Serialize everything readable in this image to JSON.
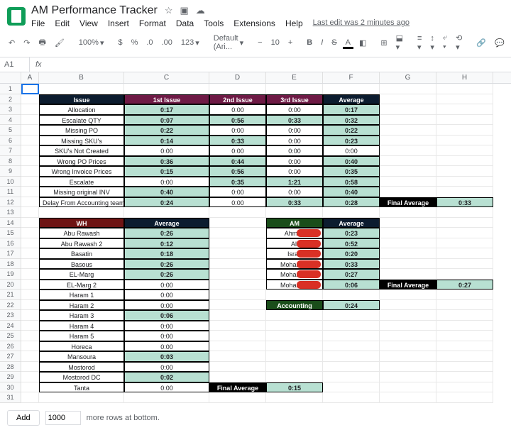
{
  "doc_title": "AM Performance Tracker",
  "menu": [
    "File",
    "Edit",
    "View",
    "Insert",
    "Format",
    "Data",
    "Tools",
    "Extensions",
    "Help"
  ],
  "last_edit": "Last edit was 2 minutes ago",
  "zoom": "100%",
  "format_num": "123",
  "font": "Default (Ari...",
  "font_size": "10",
  "namebox": "A1",
  "columns": [
    "A",
    "B",
    "C",
    "D",
    "E",
    "F",
    "G",
    "H"
  ],
  "t1": {
    "headers": [
      "Issue",
      "1st Issue",
      "2nd Issue",
      "3rd Issue",
      "Average"
    ],
    "rows": [
      {
        "label": "Allocation",
        "v": [
          "0:17",
          "0:00",
          "0:00",
          "0:17"
        ],
        "hi": [
          0,
          3
        ]
      },
      {
        "label": "Escalate QTY",
        "v": [
          "0:07",
          "0:56",
          "0:33",
          "0:32"
        ],
        "hi": [
          0,
          1,
          2,
          3
        ]
      },
      {
        "label": "Missing PO",
        "v": [
          "0:22",
          "0:00",
          "0:00",
          "0:22"
        ],
        "hi": [
          0,
          3
        ]
      },
      {
        "label": "Missing SKU's",
        "v": [
          "0:14",
          "0:33",
          "0:00",
          "0:23"
        ],
        "hi": [
          0,
          1,
          3
        ]
      },
      {
        "label": "SKU's Not Created",
        "v": [
          "0:00",
          "0:00",
          "0:00",
          "0:00"
        ],
        "hi": []
      },
      {
        "label": "Wrong PO Prices",
        "v": [
          "0:36",
          "0:44",
          "0:00",
          "0:40"
        ],
        "hi": [
          0,
          1,
          3
        ]
      },
      {
        "label": "Wrong Invoice Prices",
        "v": [
          "0:15",
          "0:56",
          "0:00",
          "0:35"
        ],
        "hi": [
          0,
          1,
          3
        ]
      },
      {
        "label": "Escalate",
        "v": [
          "0:00",
          "0:35",
          "1:21",
          "0:58"
        ],
        "hi": [
          1,
          2,
          3
        ]
      },
      {
        "label": "Missing original INV",
        "v": [
          "0:40",
          "0:00",
          "0:00",
          "0:40"
        ],
        "hi": [
          0,
          3
        ]
      },
      {
        "label": "Delay From Accounting team",
        "v": [
          "0:24",
          "0:00",
          "0:33",
          "0:28"
        ],
        "hi": [
          0,
          2,
          3
        ]
      }
    ],
    "final_label": "Final Average",
    "final": "0:33"
  },
  "t2": {
    "headers": [
      "WH",
      "Average"
    ],
    "rows": [
      {
        "l": "Abu Rawash",
        "v": "0:26",
        "hi": true
      },
      {
        "l": "Abu Rawash 2",
        "v": "0:12",
        "hi": true
      },
      {
        "l": "Basatin",
        "v": "0:18",
        "hi": true
      },
      {
        "l": "Basous",
        "v": "0:26",
        "hi": true
      },
      {
        "l": "EL-Marg",
        "v": "0:26",
        "hi": true
      },
      {
        "l": "EL-Marg 2",
        "v": "0:00",
        "hi": false
      },
      {
        "l": "Haram 1",
        "v": "0:00",
        "hi": false
      },
      {
        "l": "Haram 2",
        "v": "0:00",
        "hi": false
      },
      {
        "l": "Haram 3",
        "v": "0:06",
        "hi": true
      },
      {
        "l": "Haram 4",
        "v": "0:00",
        "hi": false
      },
      {
        "l": "Haram 5",
        "v": "0:00",
        "hi": false
      },
      {
        "l": "Horeca",
        "v": "0:00",
        "hi": false
      },
      {
        "l": "Mansoura",
        "v": "0:03",
        "hi": true
      },
      {
        "l": "Mostorod",
        "v": "0:00",
        "hi": false
      },
      {
        "l": "Mostorod DC",
        "v": "0:02",
        "hi": true
      },
      {
        "l": "Tanta",
        "v": "0:00",
        "hi": false
      }
    ],
    "final_label": "Final Average",
    "final": "0:15"
  },
  "t3": {
    "headers": [
      "AM",
      "Average"
    ],
    "rows": [
      {
        "l": "Ahmed",
        "v": "0:23"
      },
      {
        "l": "Ali",
        "v": "0:52"
      },
      {
        "l": "Israa",
        "v": "0:20"
      },
      {
        "l": "Mohamed",
        "v": "0:33"
      },
      {
        "l": "Mohamed",
        "v": "0:27"
      },
      {
        "l": "Mohamed",
        "v": "0:06"
      }
    ],
    "final_label": "Final Average",
    "final": "0:27"
  },
  "acc_label": "Accounting",
  "acc_val": "0:24",
  "add_btn": "Add",
  "add_input": "1000",
  "add_text": "more rows at bottom.",
  "chart_data": {
    "type": "table",
    "tables": [
      {
        "name": "Issue",
        "columns": [
          "Issue",
          "1st Issue",
          "2nd Issue",
          "3rd Issue",
          "Average"
        ],
        "rows": [
          [
            "Allocation",
            "0:17",
            "0:00",
            "0:00",
            "0:17"
          ],
          [
            "Escalate QTY",
            "0:07",
            "0:56",
            "0:33",
            "0:32"
          ],
          [
            "Missing PO",
            "0:22",
            "0:00",
            "0:00",
            "0:22"
          ],
          [
            "Missing SKU's",
            "0:14",
            "0:33",
            "0:00",
            "0:23"
          ],
          [
            "SKU's Not Created",
            "0:00",
            "0:00",
            "0:00",
            "0:00"
          ],
          [
            "Wrong PO Prices",
            "0:36",
            "0:44",
            "0:00",
            "0:40"
          ],
          [
            "Wrong Invoice Prices",
            "0:15",
            "0:56",
            "0:00",
            "0:35"
          ],
          [
            "Escalate",
            "0:00",
            "0:35",
            "1:21",
            "0:58"
          ],
          [
            "Missing original INV",
            "0:40",
            "0:00",
            "0:00",
            "0:40"
          ],
          [
            "Delay From Accounting team",
            "0:24",
            "0:00",
            "0:33",
            "0:28"
          ]
        ],
        "final": "0:33"
      },
      {
        "name": "WH",
        "columns": [
          "WH",
          "Average"
        ],
        "rows": [
          [
            "Abu Rawash",
            "0:26"
          ],
          [
            "Abu Rawash 2",
            "0:12"
          ],
          [
            "Basatin",
            "0:18"
          ],
          [
            "Basous",
            "0:26"
          ],
          [
            "EL-Marg",
            "0:26"
          ],
          [
            "EL-Marg 2",
            "0:00"
          ],
          [
            "Haram 1",
            "0:00"
          ],
          [
            "Haram 2",
            "0:00"
          ],
          [
            "Haram 3",
            "0:06"
          ],
          [
            "Haram 4",
            "0:00"
          ],
          [
            "Haram 5",
            "0:00"
          ],
          [
            "Horeca",
            "0:00"
          ],
          [
            "Mansoura",
            "0:03"
          ],
          [
            "Mostorod",
            "0:00"
          ],
          [
            "Mostorod DC",
            "0:02"
          ],
          [
            "Tanta",
            "0:00"
          ]
        ],
        "final": "0:15"
      },
      {
        "name": "AM",
        "columns": [
          "AM",
          "Average"
        ],
        "rows": [
          [
            "Ahmed",
            "0:23"
          ],
          [
            "Ali",
            "0:52"
          ],
          [
            "Israa",
            "0:20"
          ],
          [
            "Mohamed",
            "0:33"
          ],
          [
            "Mohamed",
            "0:27"
          ],
          [
            "Mohamed",
            "0:06"
          ]
        ],
        "final": "0:27"
      },
      {
        "name": "Accounting",
        "value": "0:24"
      }
    ]
  }
}
